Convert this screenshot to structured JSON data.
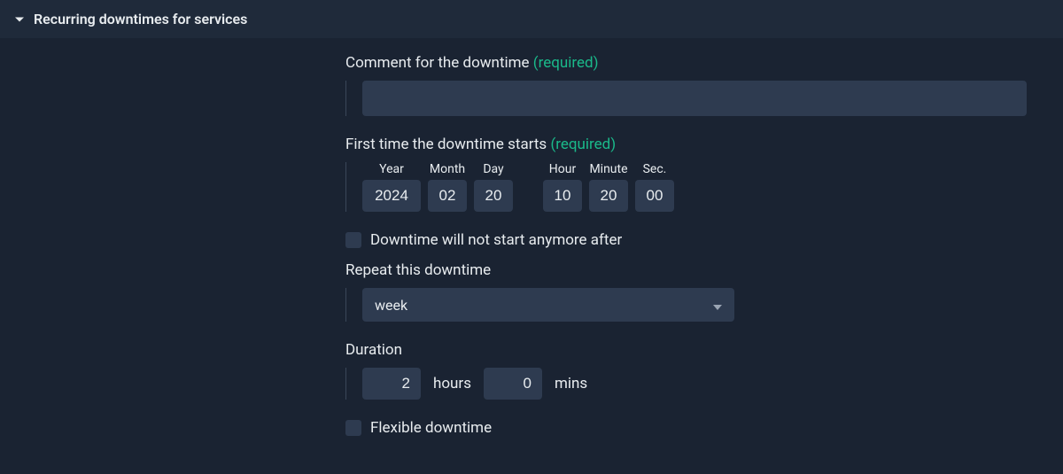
{
  "section": {
    "title": "Recurring downtimes for services"
  },
  "comment": {
    "label": "Comment for the downtime",
    "required": "(required)",
    "value": ""
  },
  "start": {
    "label": "First time the downtime starts",
    "required": "(required)",
    "headers": {
      "year": "Year",
      "month": "Month",
      "day": "Day",
      "hour": "Hour",
      "minute": "Minute",
      "sec": "Sec."
    },
    "values": {
      "year": "2024",
      "month": "02",
      "day": "20",
      "hour": "10",
      "minute": "20",
      "sec": "00"
    }
  },
  "end_enabled": {
    "label": "Downtime will not start anymore after"
  },
  "repeat": {
    "label": "Repeat this downtime",
    "value": "week"
  },
  "duration": {
    "label": "Duration",
    "hours_value": "2",
    "hours_unit": "hours",
    "mins_value": "0",
    "mins_unit": "mins"
  },
  "flexible": {
    "label": "Flexible downtime"
  }
}
